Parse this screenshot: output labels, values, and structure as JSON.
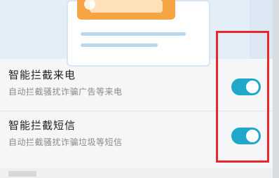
{
  "settings": {
    "items": [
      {
        "title": "智能拦截来电",
        "subtitle": "自动拦截骚扰诈骗广告等来电",
        "enabled": true
      },
      {
        "title": "智能拦截短信",
        "subtitle": "自动拦截骚扰诈骗垃圾等短信",
        "enabled": true
      }
    ]
  },
  "colors": {
    "toggle_on": "#1fa8c9",
    "highlight": "#e8272a",
    "illustration_accent": "#f7a544"
  }
}
